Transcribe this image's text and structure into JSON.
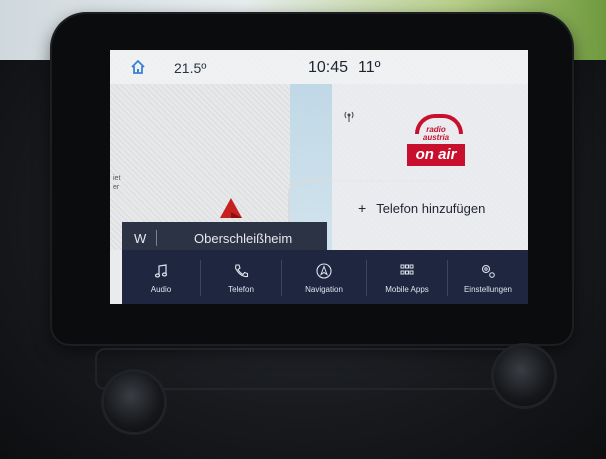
{
  "status": {
    "temperature_inside": "21.5º",
    "time": "10:45",
    "temperature_outside": "11º"
  },
  "map": {
    "edge_label": "iet\ner"
  },
  "radio": {
    "station_name_lines": "radio\naustria",
    "on_air": "on air"
  },
  "phone": {
    "add_label": "Telefon hinzufügen",
    "plus": "+"
  },
  "route": {
    "direction": "W",
    "street": "Oberschleißheim"
  },
  "tabs": [
    {
      "label": "Audio",
      "icon": "music-note-icon"
    },
    {
      "label": "Telefon",
      "icon": "phone-icon"
    },
    {
      "label": "Navigation",
      "icon": "navigation-icon"
    },
    {
      "label": "Mobile Apps",
      "icon": "apps-grid-icon"
    },
    {
      "label": "Einstellungen",
      "icon": "gear-icon"
    }
  ],
  "colors": {
    "accent_red": "#c8102e",
    "tabbar": "#1e2640",
    "route_bar": "#2c3345"
  }
}
